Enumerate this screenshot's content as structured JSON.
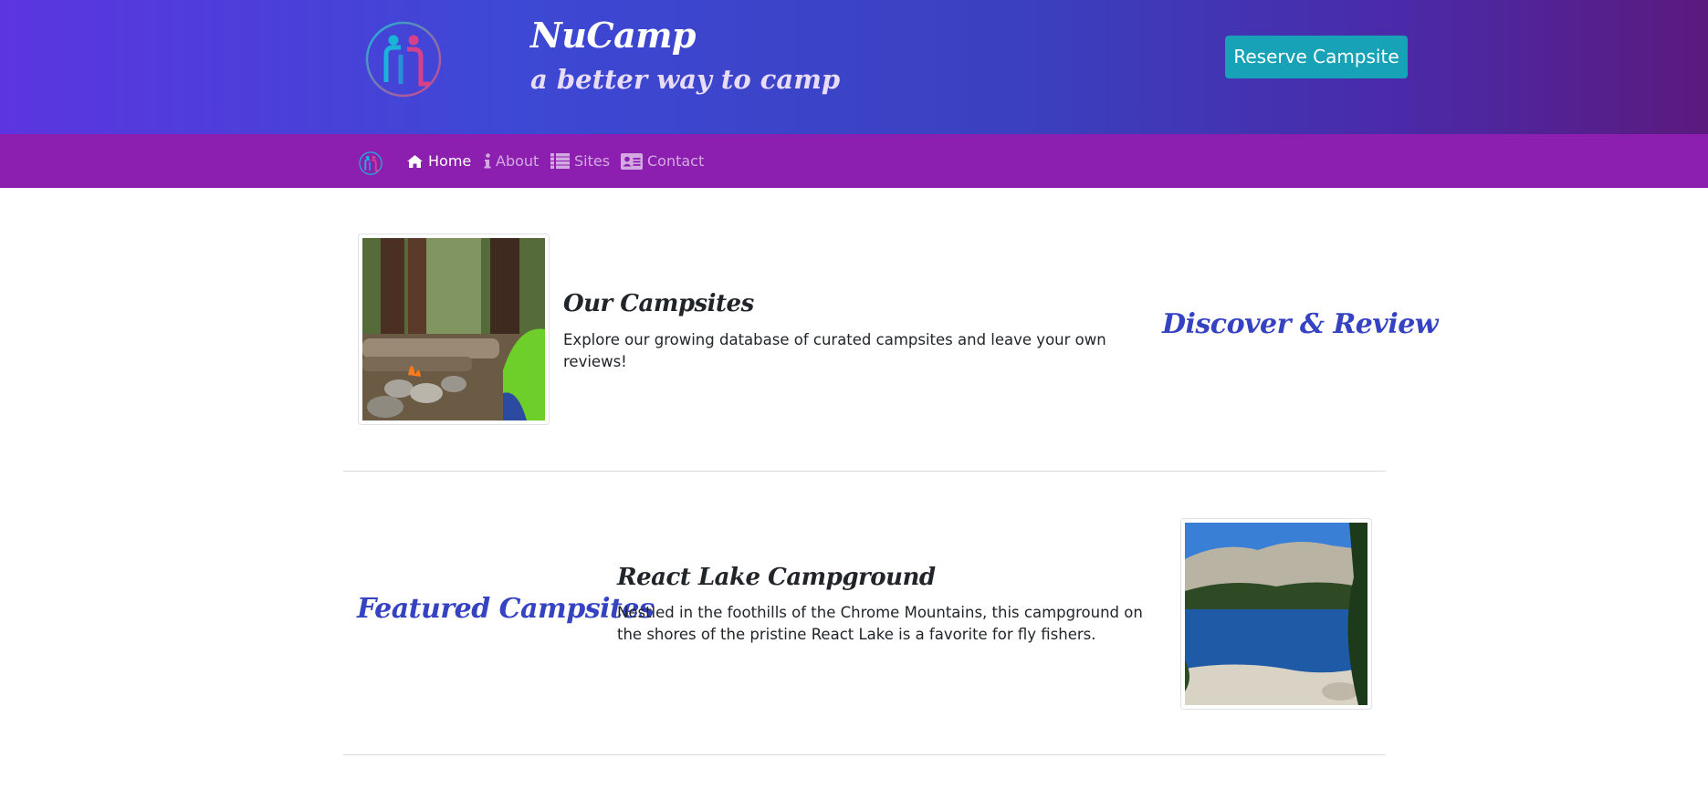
{
  "header": {
    "brand_title": "NuCamp",
    "brand_subtitle": "a better way to camp",
    "reserve_button": "Reserve Campsite",
    "logo_icon": "nucamp-logo-icon",
    "colors": {
      "gradient_start": "#5c35e0",
      "gradient_end": "#5b1a7e",
      "button": "#17a2b8"
    }
  },
  "navbar": {
    "bg_color": "#8c1eb0",
    "items": [
      {
        "label": "Home",
        "icon": "home-icon",
        "active": true
      },
      {
        "label": "About",
        "icon": "info-icon",
        "active": false
      },
      {
        "label": "Sites",
        "icon": "list-icon",
        "active": false
      },
      {
        "label": "Contact",
        "icon": "address-card-icon",
        "active": false
      }
    ]
  },
  "sections": [
    {
      "title": "Our Campsites",
      "text": "Explore our growing database of curated campsites and leave your own reviews!",
      "accent": "Discover & Review",
      "image": "campfire-forest-image"
    },
    {
      "title": "React Lake Campground",
      "text": "Nestled in the foothills of the Chrome Mountains, this campground on the shores of the pristine React Lake is a favorite for fly fishers.",
      "accent": "Featured Campsites",
      "image": "lake-image"
    }
  ],
  "accent_color": "#3543c2"
}
